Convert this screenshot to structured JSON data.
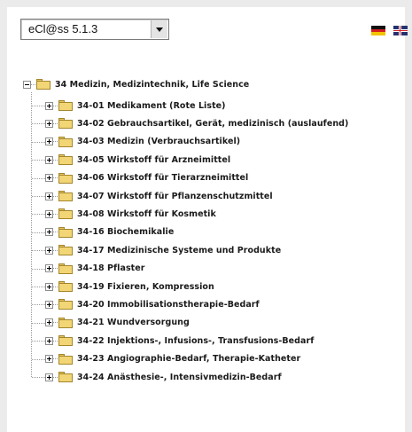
{
  "catalog_select": {
    "value": "eCl@ss 5.1.3"
  },
  "flags": [
    "german-flag-icon",
    "english-flag-icon"
  ],
  "tree": {
    "root": {
      "label": "34 Medizin, Medizintechnik, Life Science",
      "expanded": true
    },
    "children": [
      {
        "label": "34-01 Medikament (Rote Liste)"
      },
      {
        "label": "34-02 Gebrauchsartikel, Gerät, medizinisch (auslaufend)"
      },
      {
        "label": "34-03 Medizin (Verbrauchsartikel)"
      },
      {
        "label": "34-05 Wirkstoff für Arzneimittel"
      },
      {
        "label": "34-06 Wirkstoff für Tierarzneimittel"
      },
      {
        "label": "34-07 Wirkstoff für Pflanzenschutzmittel"
      },
      {
        "label": "34-08 Wirkstoff für Kosmetik"
      },
      {
        "label": "34-16 Biochemikalie"
      },
      {
        "label": "34-17 Medizinische Systeme und Produkte"
      },
      {
        "label": "34-18 Pflaster"
      },
      {
        "label": "34-19 Fixieren, Kompression"
      },
      {
        "label": "34-20 Immobilisationstherapie-Bedarf"
      },
      {
        "label": "34-21 Wundversorgung"
      },
      {
        "label": "34-22 Injektions-, Infusions-, Transfusions-Bedarf"
      },
      {
        "label": "34-23 Angiographie-Bedarf, Therapie-Katheter"
      },
      {
        "label": "34-24 Anästhesie-, Intensivmedizin-Bedarf"
      }
    ]
  }
}
